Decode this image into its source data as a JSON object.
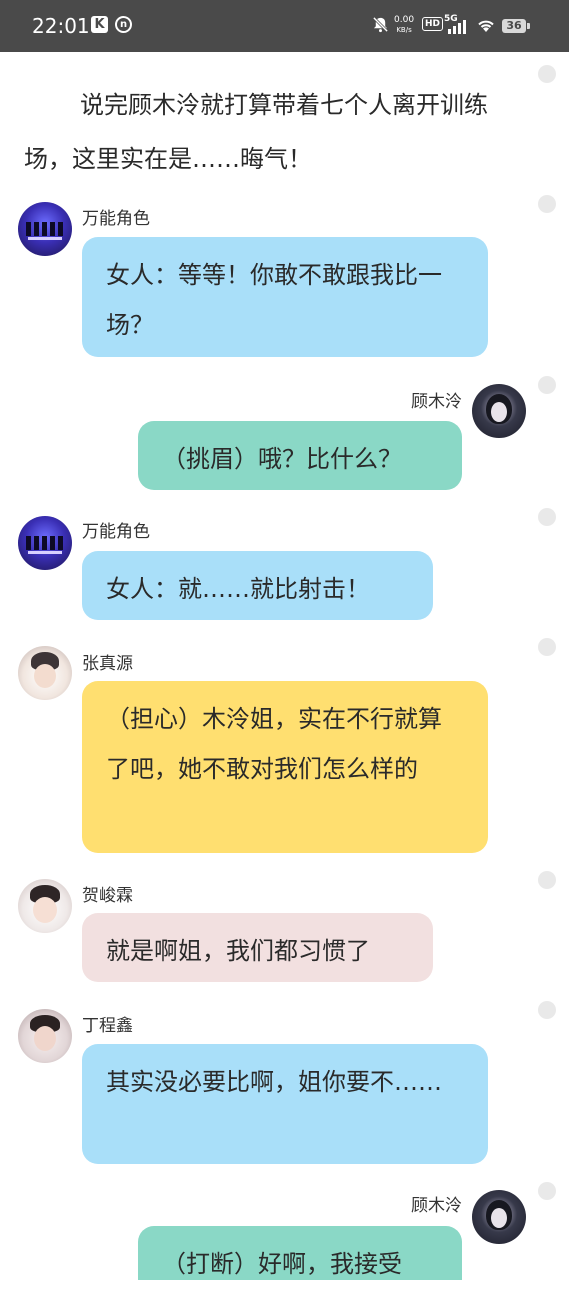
{
  "status_bar": {
    "time": "22:01",
    "app_icon_1": "K",
    "app_icon_2": "n",
    "net_speed_value": "0.00",
    "net_speed_unit": "KB/s",
    "hd_label": "HD",
    "network_label": "5G",
    "battery": "36"
  },
  "narration": "说完顾木泠就打算带着七个人离开训练场，这里实在是……晦气！",
  "messages": [
    {
      "speaker": "万能角色",
      "side": "left",
      "text": "女人：等等！你敢不敢跟我比一场？",
      "color": "#a9dff9"
    },
    {
      "speaker": "顾木泠",
      "side": "right",
      "text": "（挑眉）哦？比什么？",
      "color": "#8ad8c6"
    },
    {
      "speaker": "万能角色",
      "side": "left",
      "text": "女人：就……就比射击！",
      "color": "#a9dff9"
    },
    {
      "speaker": "张真源",
      "side": "left",
      "text": "（担心）木泠姐，实在不行就算了吧，她不敢对我们怎么样的",
      "color": "#ffdf70"
    },
    {
      "speaker": "贺峻霖",
      "side": "left",
      "text": "就是啊姐，我们都习惯了",
      "color": "#f2e0e0"
    },
    {
      "speaker": "丁程鑫",
      "side": "left",
      "text": "其实没必要比啊，姐你要不……",
      "color": "#a9dff9"
    },
    {
      "speaker": "顾木泠",
      "side": "right",
      "text": "（打断）好啊，我接受",
      "color": "#8ad8c6"
    }
  ]
}
